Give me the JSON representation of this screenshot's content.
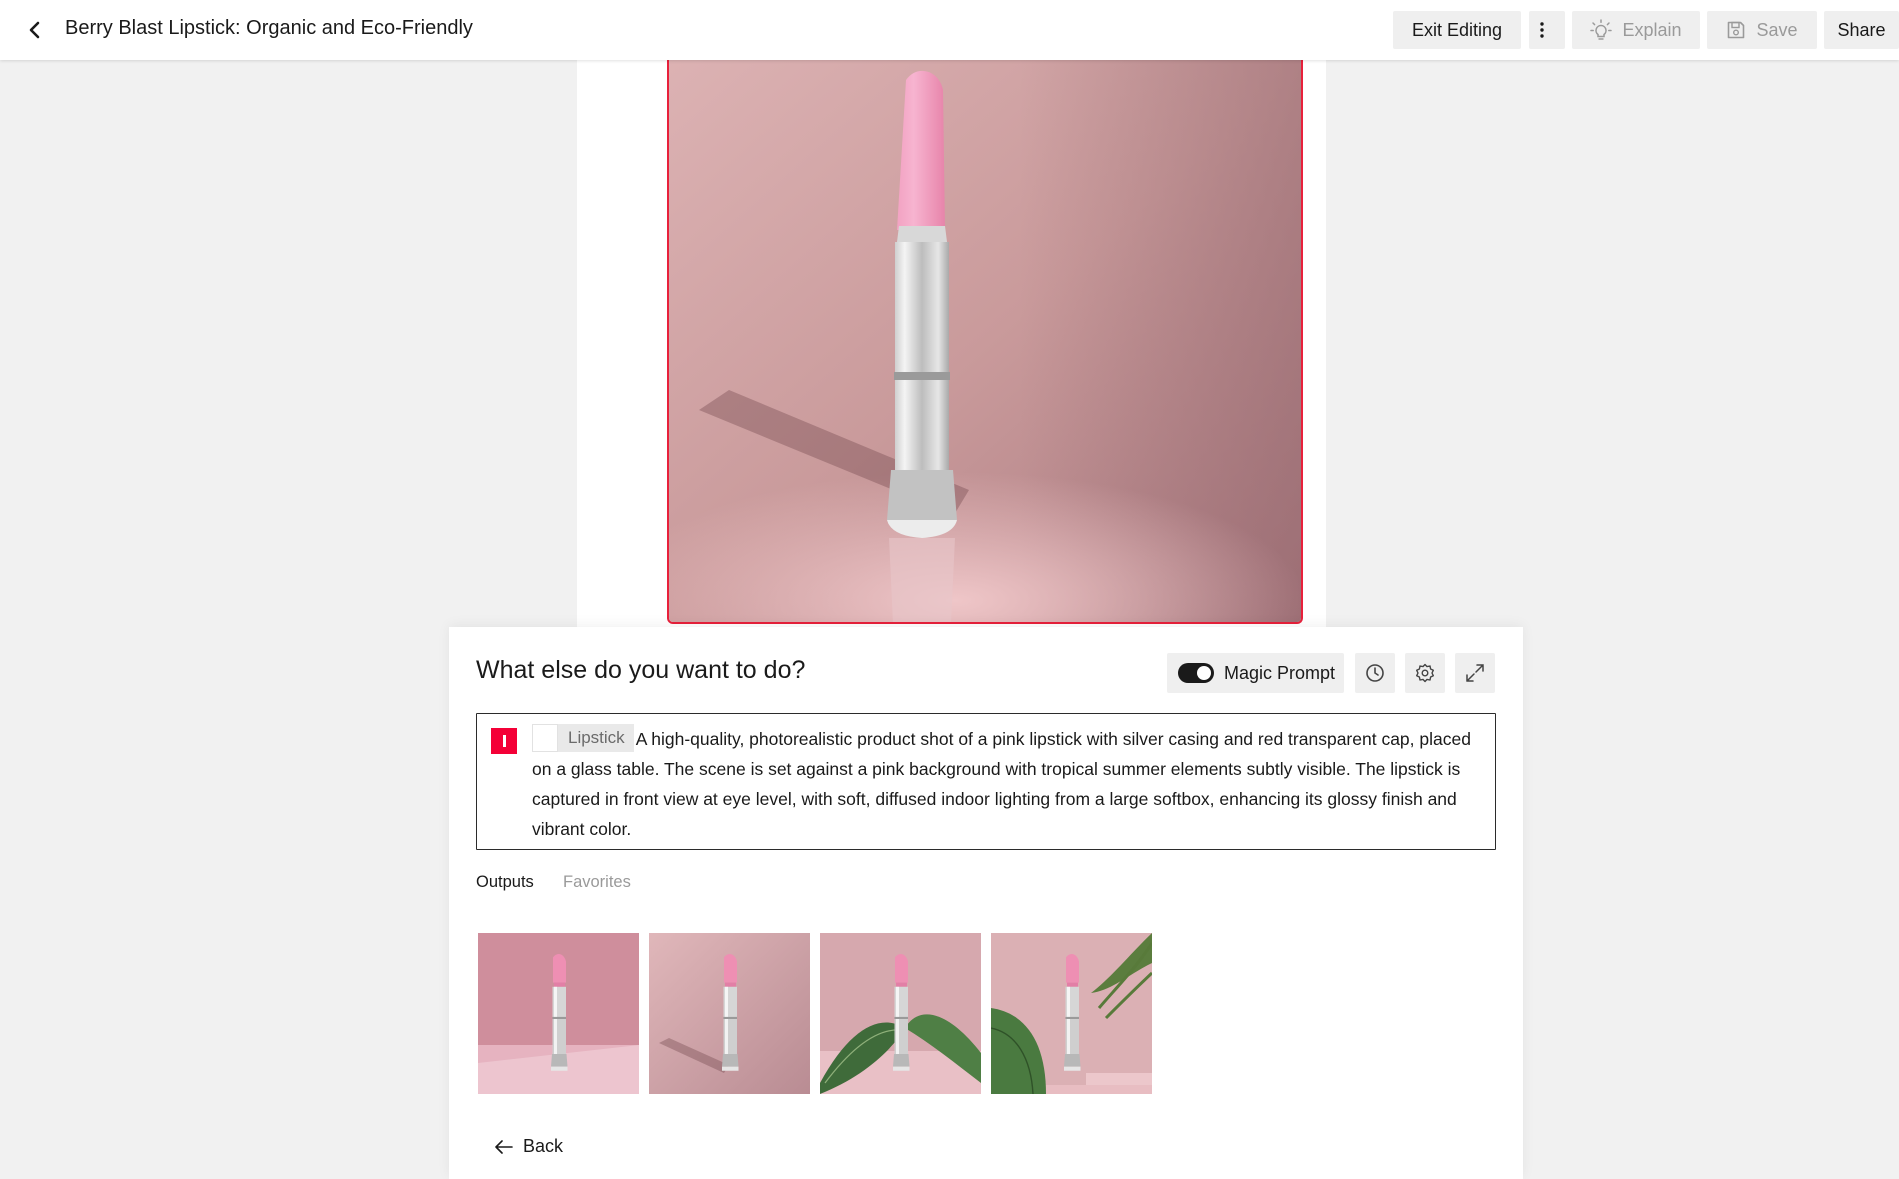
{
  "header": {
    "title": "Berry Blast Lipstick: Organic and Eco-Friendly",
    "exit_editing_label": "Exit Editing",
    "explain_label": "Explain",
    "save_label": "Save",
    "share_label": "Share"
  },
  "panel": {
    "title": "What else do you want to do?",
    "magic_prompt_label": "Magic Prompt",
    "magic_prompt_on": true,
    "prompt": {
      "chip_label": "Lipstick",
      "text": "A high-quality, photorealistic product shot of a pink lipstick with silver casing and red transparent cap, placed on a glass table. The scene is set against a pink background with tropical summer elements subtly visible. The lipstick is captured in front view at eye level, with soft, diffused indoor lighting from a large softbox, enhancing its glossy finish and vibrant color."
    },
    "tabs": [
      {
        "label": "Outputs",
        "active": true
      },
      {
        "label": "Favorites",
        "active": false
      }
    ],
    "outputs_count": 4,
    "back_label": "Back"
  },
  "colors": {
    "accent_red": "#f40037",
    "selection_border": "#e8203b",
    "background": "#f1f1f1",
    "lipstick_pink": "#ee8fb3"
  },
  "icons": [
    "chevron-left-icon",
    "more-vertical-icon",
    "lightbulb-icon",
    "save-icon",
    "history-icon",
    "settings-icon",
    "expand-icon",
    "arrow-left-icon"
  ]
}
